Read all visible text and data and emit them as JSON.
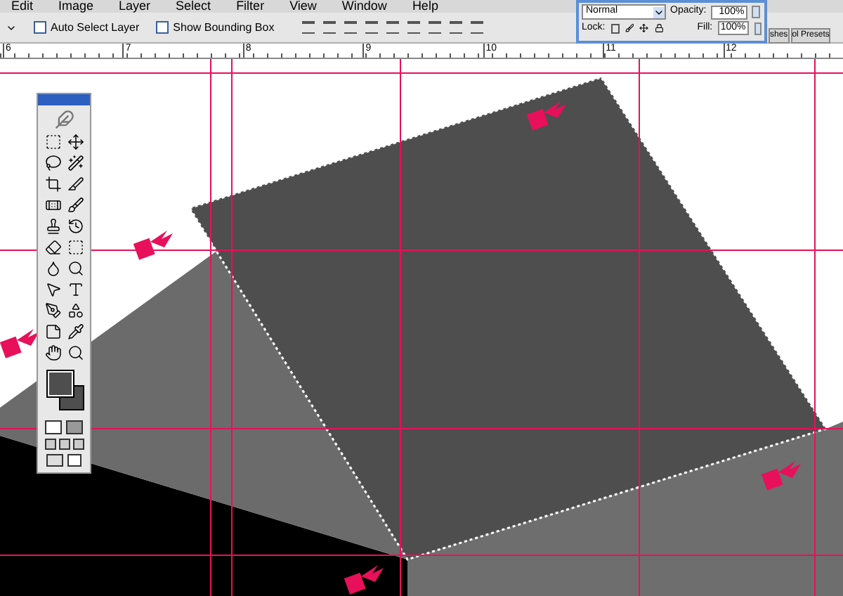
{
  "menu": [
    "Edit",
    "Image",
    "Layer",
    "Select",
    "Filter",
    "View",
    "Window",
    "Help"
  ],
  "options_bar": {
    "checkboxes": [
      {
        "label": "Auto Select Layer",
        "checked": false
      },
      {
        "label": "Show Bounding Box",
        "checked": false
      }
    ]
  },
  "ruler": [
    "6",
    "7",
    "8",
    "9",
    "10",
    "11",
    "12"
  ],
  "layers_panel": {
    "tabs": [
      "shes",
      "ol Presets"
    ],
    "blend_mode": "Normal",
    "opacity_label": "Opacity:",
    "opacity": "100%",
    "lock_label": "Lock:",
    "fill_label": "Fill:",
    "fill": "100%"
  }
}
